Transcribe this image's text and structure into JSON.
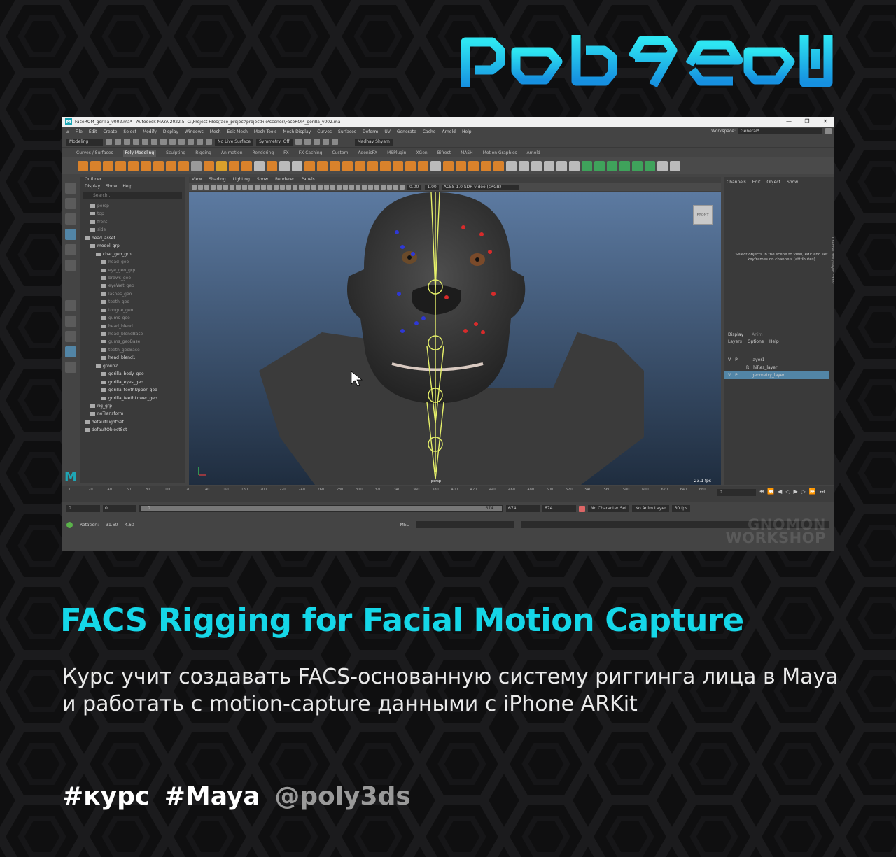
{
  "brand": {
    "logo_text": "poly3ds"
  },
  "maya": {
    "window_title": "FaceROM_gorilla_v002.ma* - Autodesk MAYA 2022.5: C:\\Project Files\\face_project\\projectFile\\scenes\\FaceROM_gorilla_v002.ma",
    "menu": [
      "File",
      "Edit",
      "Create",
      "Select",
      "Modify",
      "Display",
      "Windows",
      "Mesh",
      "Edit Mesh",
      "Mesh Tools",
      "Mesh Display",
      "Curves",
      "Surfaces",
      "Deform",
      "UV",
      "Generate",
      "Cache",
      "Arnold",
      "Help"
    ],
    "workspace_label": "Workspace:",
    "workspace_value": "General*",
    "status": {
      "mode": "Modeling",
      "live_surface": "No Live Surface",
      "symmetry": "Symmetry: Off",
      "user": "Madhav Shyam"
    },
    "shelf_tabs": [
      "Curves / Surfaces",
      "Poly Modeling",
      "Sculpting",
      "Rigging",
      "Animation",
      "Rendering",
      "FX",
      "FX Caching",
      "Custom",
      "AdonisFX",
      "MSPlugin",
      "XGen",
      "Bifrost",
      "MASH",
      "Motion Graphics",
      "Arnold"
    ],
    "shelf_active": "Poly Modeling",
    "outliner": {
      "title": "Outliner",
      "menu": [
        "Display",
        "Show",
        "Help"
      ],
      "search_placeholder": "Search...",
      "rows": [
        {
          "label": "persp",
          "dim": true,
          "indent": 1
        },
        {
          "label": "top",
          "dim": true,
          "indent": 1
        },
        {
          "label": "front",
          "dim": true,
          "indent": 1
        },
        {
          "label": "side",
          "dim": true,
          "indent": 1
        },
        {
          "label": "head_asset",
          "dim": false,
          "indent": 0
        },
        {
          "label": "model_grp",
          "dim": false,
          "indent": 1
        },
        {
          "label": "char_geo_grp",
          "dim": false,
          "indent": 2
        },
        {
          "label": "head_geo",
          "dim": true,
          "indent": 3
        },
        {
          "label": "eye_geo_grp",
          "dim": true,
          "indent": 3
        },
        {
          "label": "brows_geo",
          "dim": true,
          "indent": 3
        },
        {
          "label": "eyeWet_geo",
          "dim": true,
          "indent": 3
        },
        {
          "label": "lashes_geo",
          "dim": true,
          "indent": 3
        },
        {
          "label": "teeth_geo",
          "dim": true,
          "indent": 3
        },
        {
          "label": "tongue_geo",
          "dim": true,
          "indent": 3
        },
        {
          "label": "gums_geo",
          "dim": true,
          "indent": 3
        },
        {
          "label": "head_blend",
          "dim": true,
          "indent": 3
        },
        {
          "label": "head_blendBase",
          "dim": true,
          "indent": 3
        },
        {
          "label": "gums_geoBase",
          "dim": true,
          "indent": 3
        },
        {
          "label": "teeth_geoBase",
          "dim": true,
          "indent": 3
        },
        {
          "label": "head_blend1",
          "dim": false,
          "indent": 3
        },
        {
          "label": "group2",
          "dim": false,
          "indent": 2
        },
        {
          "label": "gorilla_body_geo",
          "dim": false,
          "indent": 3
        },
        {
          "label": "gorilla_eyes_geo",
          "dim": false,
          "indent": 3
        },
        {
          "label": "gorilla_teethUpper_geo",
          "dim": false,
          "indent": 3
        },
        {
          "label": "gorilla_teethLower_geo",
          "dim": false,
          "indent": 3
        },
        {
          "label": "rig_grp",
          "dim": false,
          "indent": 1
        },
        {
          "label": "noTransform",
          "dim": false,
          "indent": 1
        },
        {
          "label": "defaultLightSet",
          "dim": false,
          "indent": 0
        },
        {
          "label": "defaultObjectSet",
          "dim": false,
          "indent": 0
        }
      ]
    },
    "viewport": {
      "menu": [
        "View",
        "Shading",
        "Lighting",
        "Show",
        "Renderer",
        "Panels"
      ],
      "exposure": "0.00",
      "gamma": "1.00",
      "color_space": "ACES 1.0 SDR-video (sRGB)",
      "view_cube": "FRONT",
      "camera": "persp",
      "fps": "23.1 fps"
    },
    "channel_box": {
      "menu": [
        "Channels",
        "Edit",
        "Object",
        "Show"
      ],
      "message": "Select objects in the scene to view, edit and set keyframes on channels (attributes)",
      "side_tabs": "Channel Box / Layer Editor",
      "layer_tabs": [
        "Display",
        "Anim"
      ],
      "layer_menu": [
        "Layers",
        "Options",
        "Help"
      ],
      "layers": [
        {
          "v": "V",
          "p": "P",
          "name": "layer1",
          "selected": false
        },
        {
          "v": "",
          "p": "R",
          "name": "hiRes_layer",
          "selected": false
        },
        {
          "v": "V",
          "p": "P",
          "name": "geometry_layer",
          "selected": true
        }
      ]
    },
    "timeline": {
      "ticks": [
        "0",
        "20",
        "40",
        "60",
        "80",
        "100",
        "120",
        "140",
        "160",
        "180",
        "200",
        "220",
        "240",
        "260",
        "280",
        "300",
        "320",
        "340",
        "360",
        "380",
        "400",
        "420",
        "440",
        "460",
        "480",
        "500",
        "520",
        "540",
        "560",
        "580",
        "600",
        "620",
        "640",
        "660"
      ],
      "current_frame": "0"
    },
    "range": {
      "start": "0",
      "start2": "0",
      "slider_start": "0",
      "slider_end": "674",
      "end": "674",
      "end2": "674",
      "character_set": "No Character Set",
      "anim_layer": "No Anim Layer",
      "fps": "30 fps"
    },
    "help_line": {
      "label": "Rotation:",
      "v1": "31.60",
      "v2": "4.60",
      "cmd": "MEL"
    },
    "watermark_line1": "GNOMON",
    "watermark_line2": "WORKSHOP"
  },
  "headline": "FACS Rigging for Facial Motion Capture",
  "description": "Курс учит создавать FACS-основанную систему риггинга лица в Maya и работать с motion-capture данными с iPhone ARKit",
  "tags": {
    "tag1": "#курс",
    "tag2": "#Maya",
    "handle": "@poly3ds"
  },
  "colors": {
    "accent": "#15d7e8",
    "background": "#0f0f10",
    "handle": "#9a9a9a"
  }
}
